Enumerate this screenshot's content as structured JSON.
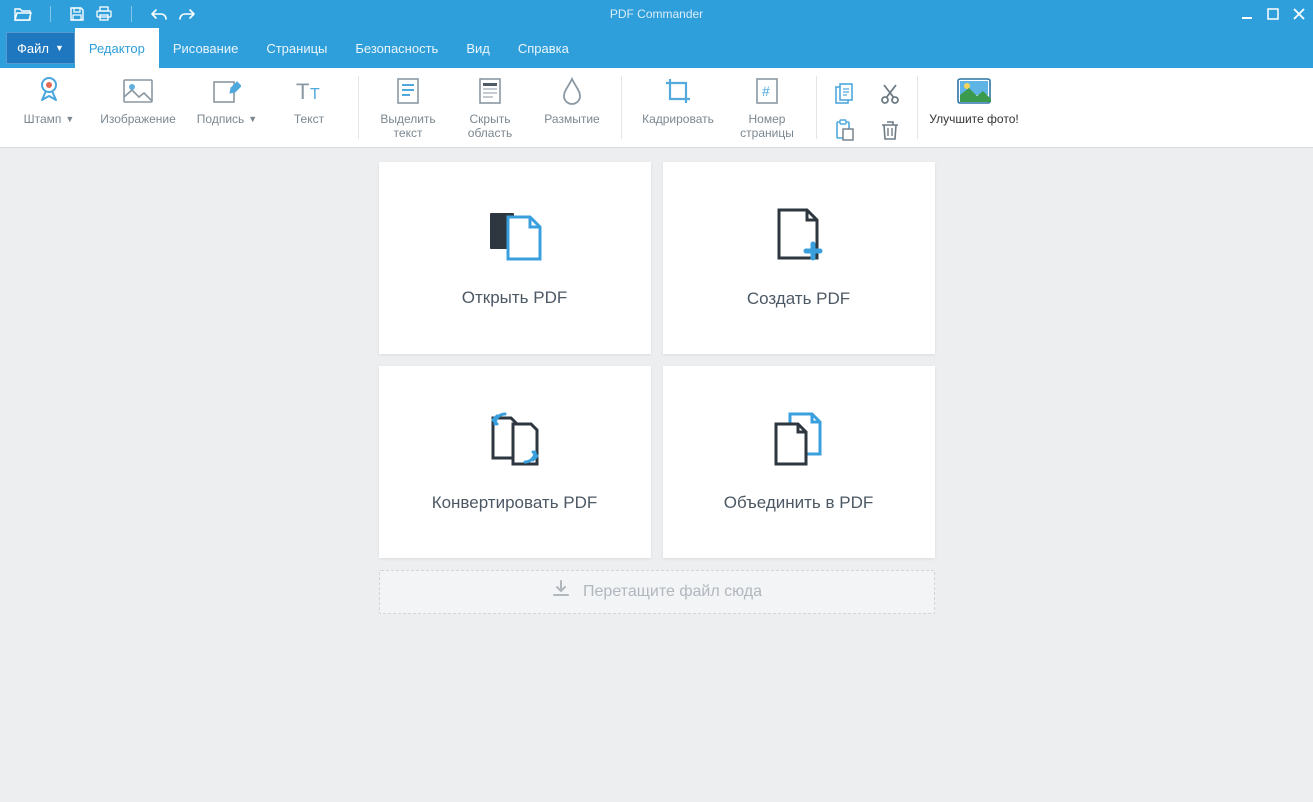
{
  "app": {
    "title": "PDF Commander"
  },
  "menu": {
    "file": "Файл",
    "editor": "Редактор",
    "drawing": "Рисование",
    "pages": "Страницы",
    "security": "Безопасность",
    "view": "Вид",
    "help": "Справка"
  },
  "ribbon": {
    "stamp": "Штамп",
    "image": "Изображение",
    "signature": "Подпись",
    "text": "Текст",
    "highlight": "Выделить\nтекст",
    "hide_area": "Скрыть\nобласть",
    "blur": "Размытие",
    "crop": "Кадрировать",
    "pagenum": "Номер\nстраницы",
    "enhance_photo": "Улучшите фото!"
  },
  "start": {
    "open": "Открыть PDF",
    "create": "Создать PDF",
    "convert": "Конвертировать PDF",
    "merge": "Объединить в PDF",
    "drop": "Перетащите файл сюда"
  }
}
